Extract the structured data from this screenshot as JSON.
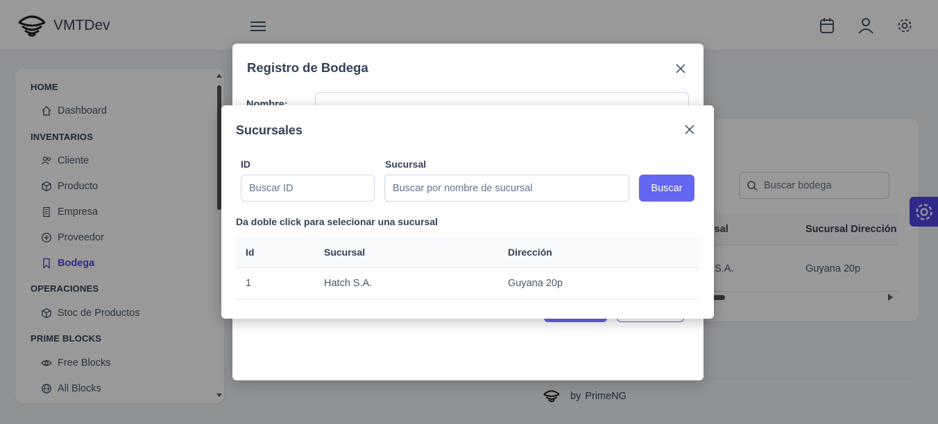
{
  "app": {
    "title": "VMTDev"
  },
  "topbar": {
    "icons": [
      "menu-icon",
      "calendar-icon",
      "user-icon",
      "gear-icon"
    ]
  },
  "sidebar": {
    "sections": [
      {
        "label": "HOME",
        "items": [
          {
            "label": "Dashboard",
            "icon": "home-icon"
          }
        ]
      },
      {
        "label": "INVENTARIOS",
        "items": [
          {
            "label": "Cliente",
            "icon": "users-icon"
          },
          {
            "label": "Producto",
            "icon": "box-icon"
          },
          {
            "label": "Empresa",
            "icon": "building-icon"
          },
          {
            "label": "Proveedor",
            "icon": "plus-circle-icon"
          },
          {
            "label": "Bodega",
            "icon": "bookmark-icon",
            "active": true
          }
        ]
      },
      {
        "label": "OPERACIONES",
        "items": [
          {
            "label": "Stoc de Productos",
            "icon": "box-icon"
          }
        ]
      },
      {
        "label": "PRIME BLOCKS",
        "items": [
          {
            "label": "Free Blocks",
            "icon": "eye-icon"
          },
          {
            "label": "All Blocks",
            "icon": "globe-icon"
          }
        ]
      }
    ]
  },
  "background": {
    "search_placeholder": "Buscar bodega",
    "columns": [
      "rsal",
      "Sucursal Dirección"
    ],
    "row": [
      "S.A.",
      "Guyana 20p"
    ]
  },
  "footer": {
    "by": "by",
    "brand": "PrimeNG"
  },
  "dialog_bodega": {
    "title": "Registro de Bodega",
    "nombre_label": "Nombre:"
  },
  "dialog_sucursales": {
    "title": "Sucursales",
    "id_label": "ID",
    "id_placeholder": "Buscar ID",
    "sucursal_label": "Sucursal",
    "sucursal_placeholder": "Buscar por nombre de sucursal",
    "search_button": "Buscar",
    "hint": "Da doble click para selecionar una sucursal",
    "columns": [
      "Id",
      "Sucursal",
      "Dirección"
    ],
    "rows": [
      {
        "id": "1",
        "sucursal": "Hatch S.A.",
        "direccion": "Guyana 20p"
      }
    ]
  },
  "colors": {
    "primary": "#6366f1",
    "active": "#4f46e5",
    "overlay": "rgba(0,0,0,0.4)"
  }
}
